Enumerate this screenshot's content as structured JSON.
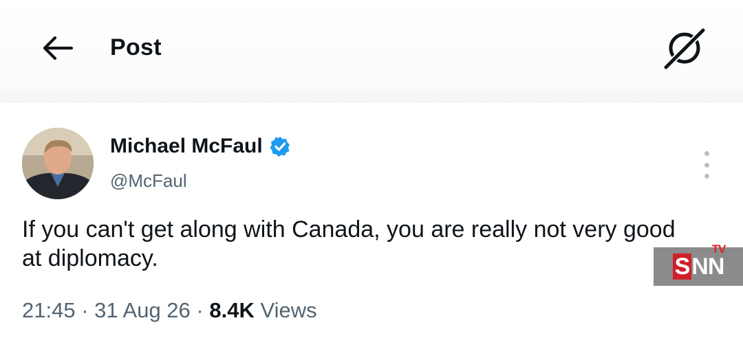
{
  "header": {
    "title": "Post"
  },
  "author": {
    "name": "Michael McFaul",
    "handle": "@McFaul",
    "verified": true
  },
  "tweet": {
    "text": "If you can't get along with Canada, you are really not very good at diplomacy.",
    "time": "21:45",
    "date": "31 Aug 26",
    "separator": "·",
    "views_count": "8.4K",
    "views_label": "Views"
  },
  "watermark": {
    "s": "S",
    "nn": "NN",
    "tv": "TV"
  },
  "icons": {
    "back": "arrow-left-icon",
    "grok": "grok-icon",
    "verified": "verified-badge-icon",
    "more": "more-vertical-icon"
  },
  "colors": {
    "verified": "#1d9bf0",
    "secondary_text": "#536471",
    "watermark_red": "#d0202a"
  }
}
